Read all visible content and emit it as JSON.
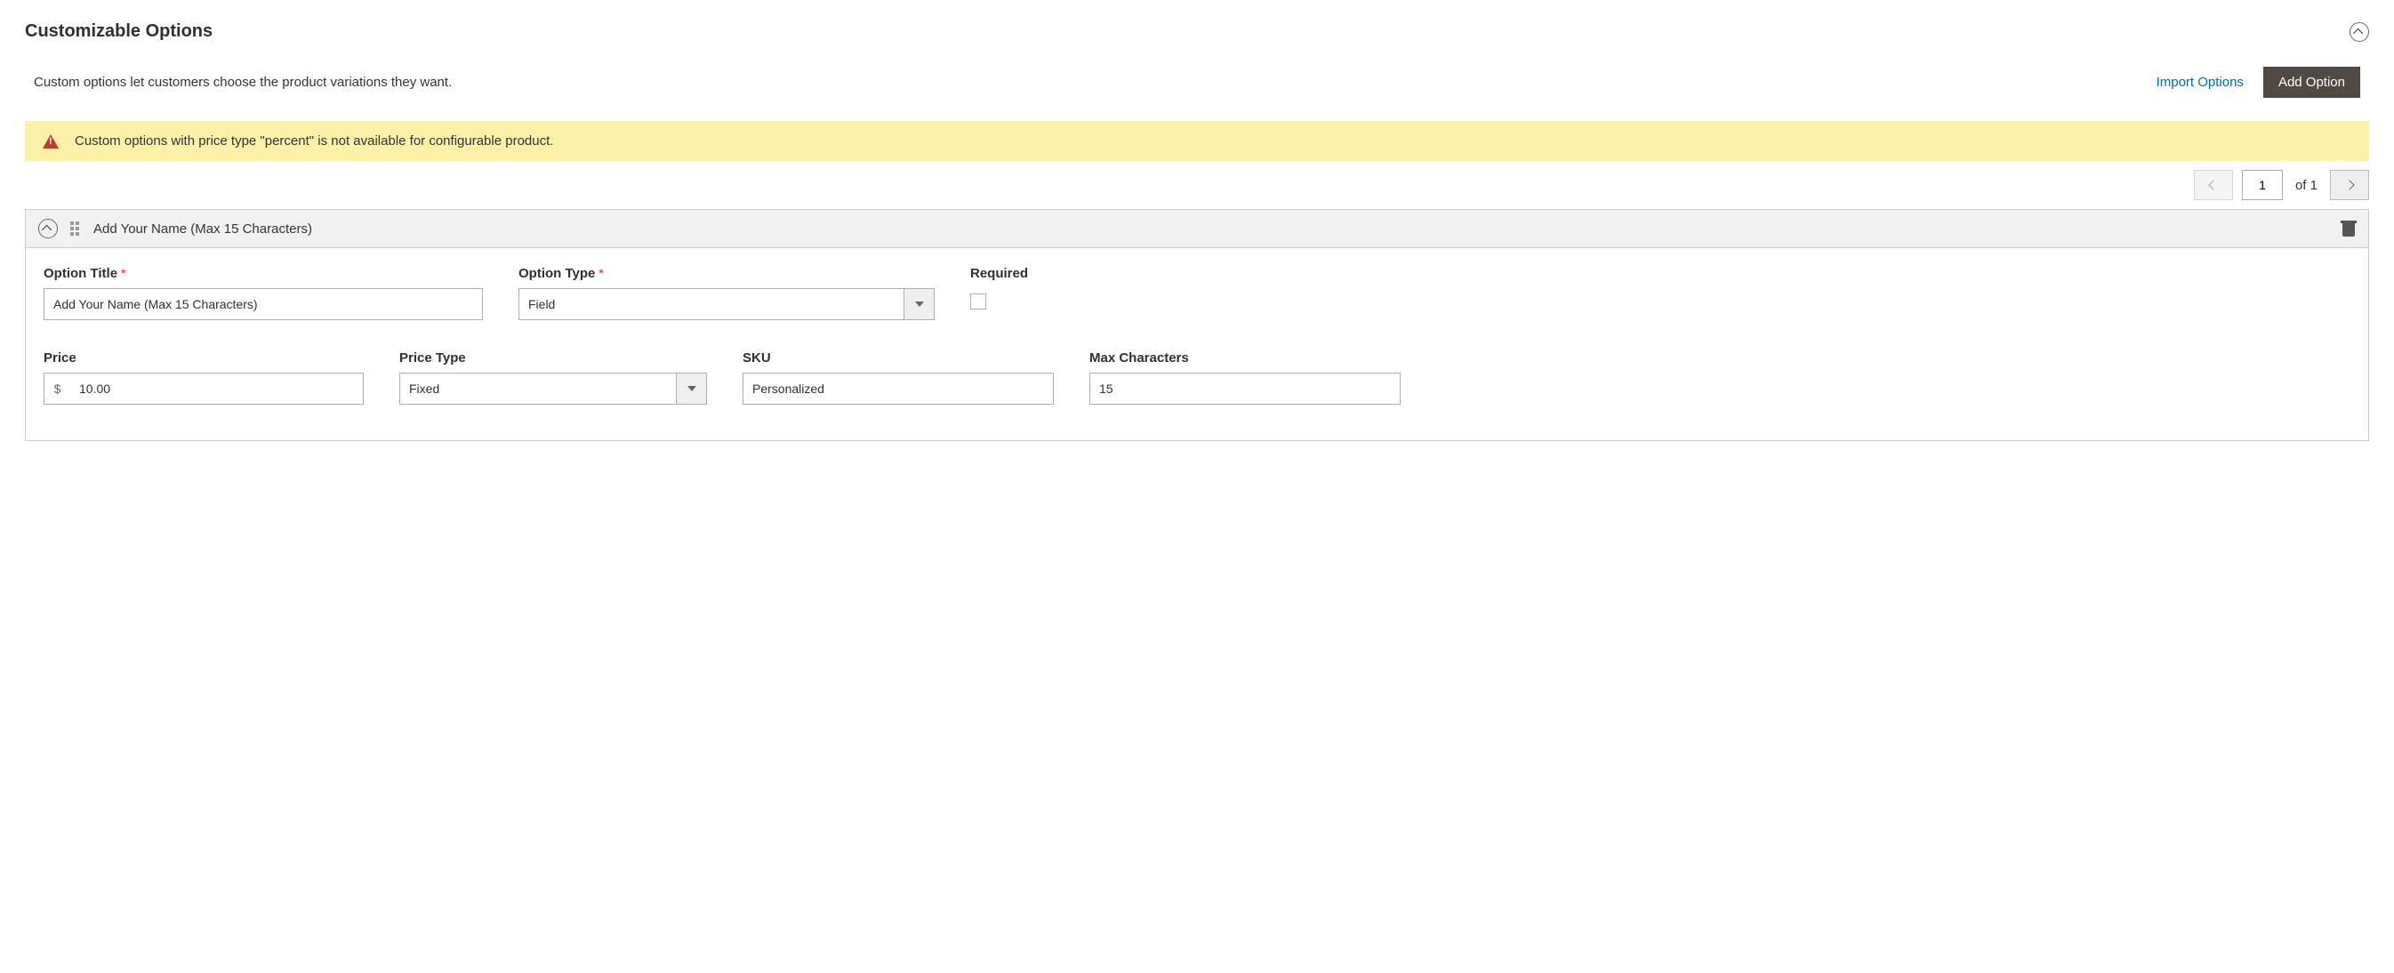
{
  "section": {
    "title": "Customizable Options",
    "description": "Custom options let customers choose the product variations they want."
  },
  "actions": {
    "import_label": "Import Options",
    "add_label": "Add Option"
  },
  "alert": {
    "message": "Custom options with price type \"percent\" is not available for configurable product."
  },
  "pager": {
    "current": "1",
    "total_label": "of 1"
  },
  "option": {
    "header_title": "Add Your Name (Max 15 Characters)",
    "labels": {
      "title": "Option Title",
      "type": "Option Type",
      "required": "Required",
      "price": "Price",
      "price_type": "Price Type",
      "sku": "SKU",
      "max_chars": "Max Characters"
    },
    "values": {
      "title": "Add Your Name (Max 15 Characters)",
      "type": "Field",
      "required": false,
      "price_prefix": "$",
      "price": "10.00",
      "price_type": "Fixed",
      "sku": "Personalized",
      "max_chars": "15"
    }
  }
}
